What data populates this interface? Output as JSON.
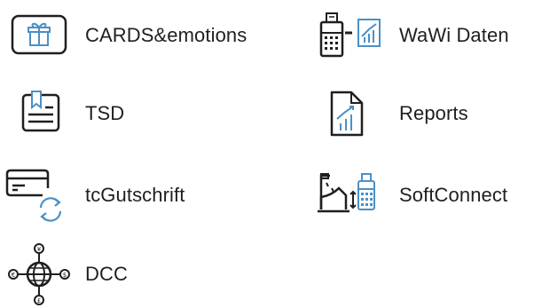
{
  "tiles": [
    {
      "id": "cards-emotions",
      "label": "CARDS&emotions",
      "icon": "gift-icon"
    },
    {
      "id": "wawi-daten",
      "label": "WaWi Daten",
      "icon": "register-to-chart-icon"
    },
    {
      "id": "tsd",
      "label": "TSD",
      "icon": "id-card-icon"
    },
    {
      "id": "reports",
      "label": "Reports",
      "icon": "report-document-icon"
    },
    {
      "id": "tcgutschrift",
      "label": "tcGutschrift",
      "icon": "card-refresh-icon"
    },
    {
      "id": "softconnect",
      "label": "SoftConnect",
      "icon": "register-sync-icon"
    },
    {
      "id": "dcc",
      "label": "DCC",
      "icon": "currency-globe-icon"
    }
  ],
  "colors": {
    "accent": "#4a90c8",
    "text": "#1f1f1f",
    "icon_stroke": "#1f1f1f"
  }
}
